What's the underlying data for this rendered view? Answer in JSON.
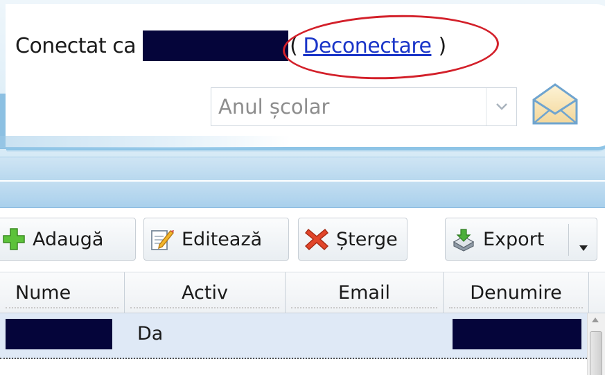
{
  "header": {
    "logged_in_prefix": "Conectat ca",
    "paren_open": "(",
    "logout_label": "Deconectare",
    "paren_close": ")",
    "school_year_placeholder": "Anul școlar"
  },
  "toolbar": {
    "add_label": "Adaugă",
    "edit_label": "Editează",
    "delete_label": "Șterge",
    "export_label": "Export"
  },
  "grid": {
    "columns": [
      "Nume",
      "Activ",
      "Email",
      "Denumire"
    ],
    "rows": [
      {
        "activ": "Da"
      }
    ]
  },
  "colors": {
    "accent": "#1a35c8",
    "highlight": "#d3202a",
    "redaction": "#05053a",
    "row_selected": "#dfe9f6"
  }
}
